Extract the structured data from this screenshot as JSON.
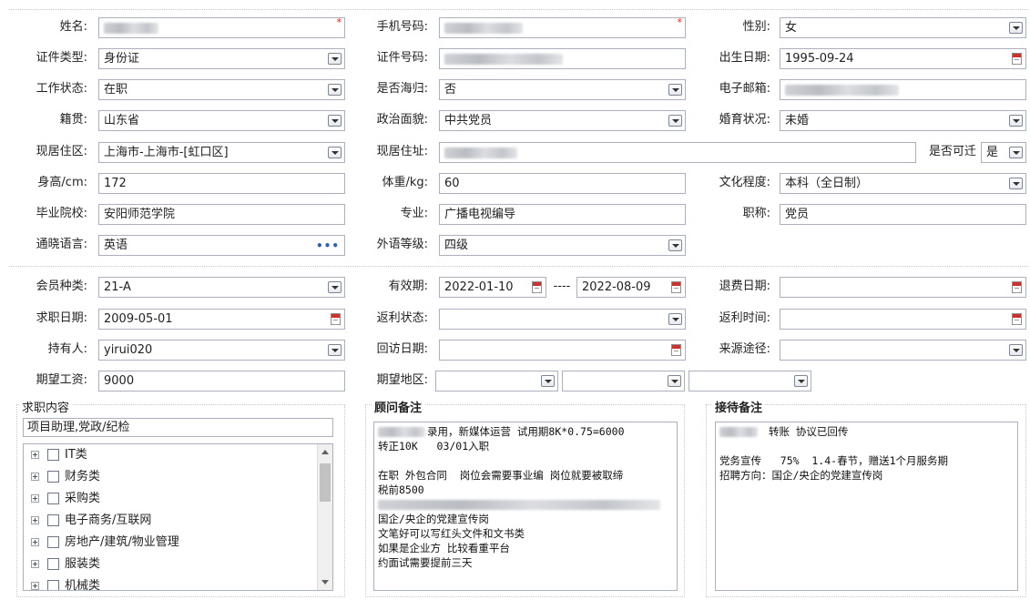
{
  "personal": {
    "name": {
      "label": "姓名:",
      "value": "",
      "required_mark": "*"
    },
    "phone": {
      "label": "手机号码:",
      "value": "",
      "required_mark": "*"
    },
    "gender": {
      "label": "性别:",
      "value": "女"
    },
    "id_type": {
      "label": "证件类型:",
      "value": "身份证"
    },
    "id_number": {
      "label": "证件号码:",
      "value": ""
    },
    "birth_date": {
      "label": "出生日期:",
      "value": "1995-09-24"
    },
    "work_status": {
      "label": "工作状态:",
      "value": "在职"
    },
    "overseas": {
      "label": "是否海归:",
      "value": "否"
    },
    "email": {
      "label": "电子邮箱:",
      "value": ""
    },
    "native_place": {
      "label": "籍贯:",
      "value": "山东省"
    },
    "political": {
      "label": "政治面貌:",
      "value": "中共党员"
    },
    "marital": {
      "label": "婚育状况:",
      "value": "未婚"
    },
    "residence_area": {
      "label": "现居住区:",
      "value": "上海市-上海市-[虹口区]"
    },
    "residence_addr": {
      "label": "现居住址:",
      "value": ""
    },
    "relocate": {
      "label": "是否可迁",
      "value": "是"
    },
    "height": {
      "label": "身高/cm:",
      "value": "172"
    },
    "weight": {
      "label": "体重/kg:",
      "value": "60"
    },
    "education": {
      "label": "文化程度:",
      "value": "本科（全日制）"
    },
    "school": {
      "label": "毕业院校:",
      "value": "安阳师范学院"
    },
    "major": {
      "label": "专业:",
      "value": "广播电视编导"
    },
    "title": {
      "label": "职称:",
      "value": "党员"
    },
    "languages": {
      "label": "通晓语言:",
      "value": "英语"
    },
    "lang_level": {
      "label": "外语等级:",
      "value": "四级"
    }
  },
  "membership": {
    "member_type": {
      "label": "会员种类:",
      "value": "21-A"
    },
    "valid_period": {
      "label": "有效期:",
      "from": "2022-01-10",
      "sep": "----",
      "to": "2022-08-09"
    },
    "refund_date": {
      "label": "退费日期:",
      "value": ""
    },
    "job_seek_date": {
      "label": "求职日期:",
      "value": "2009-05-01"
    },
    "rebate_status": {
      "label": "返利状态:",
      "value": ""
    },
    "rebate_time": {
      "label": "返利时间:",
      "value": ""
    },
    "holder": {
      "label": "持有人:",
      "value": "yirui020"
    },
    "visit_date": {
      "label": "回访日期:",
      "value": ""
    },
    "source": {
      "label": "来源途径:",
      "value": ""
    },
    "salary": {
      "label": "期望工资:",
      "value": "9000"
    },
    "region": {
      "label": "期望地区:"
    }
  },
  "job_panel": {
    "title": "求职内容",
    "selected": "项目助理,党政/纪检",
    "tree": [
      "IT类",
      "财务类",
      "采购类",
      "电子商务/互联网",
      "房地产/建筑/物业管理",
      "服装类",
      "机械类"
    ]
  },
  "consultant_panel": {
    "title": "顾问备注",
    "lines": [
      "录用，新媒体运营 试用期8K*0.75=6000",
      "转正10K   03/01入职",
      "",
      "在职 外包合同  岗位会需要事业编 岗位就要被取缔",
      "税前8500",
      "",
      "国企/央企的党建宣传岗",
      "文笔好可以写红头文件和文书类",
      "如果是企业方 比较看重平台",
      "约面试需要提前三天"
    ]
  },
  "reception_panel": {
    "title": "接待备注",
    "lines": [
      "转账 协议已回传",
      "",
      "党务宣传   75%  1.4-春节，赠送1个月服务期",
      "招聘方向：国企/央企的党建宣传岗"
    ]
  }
}
